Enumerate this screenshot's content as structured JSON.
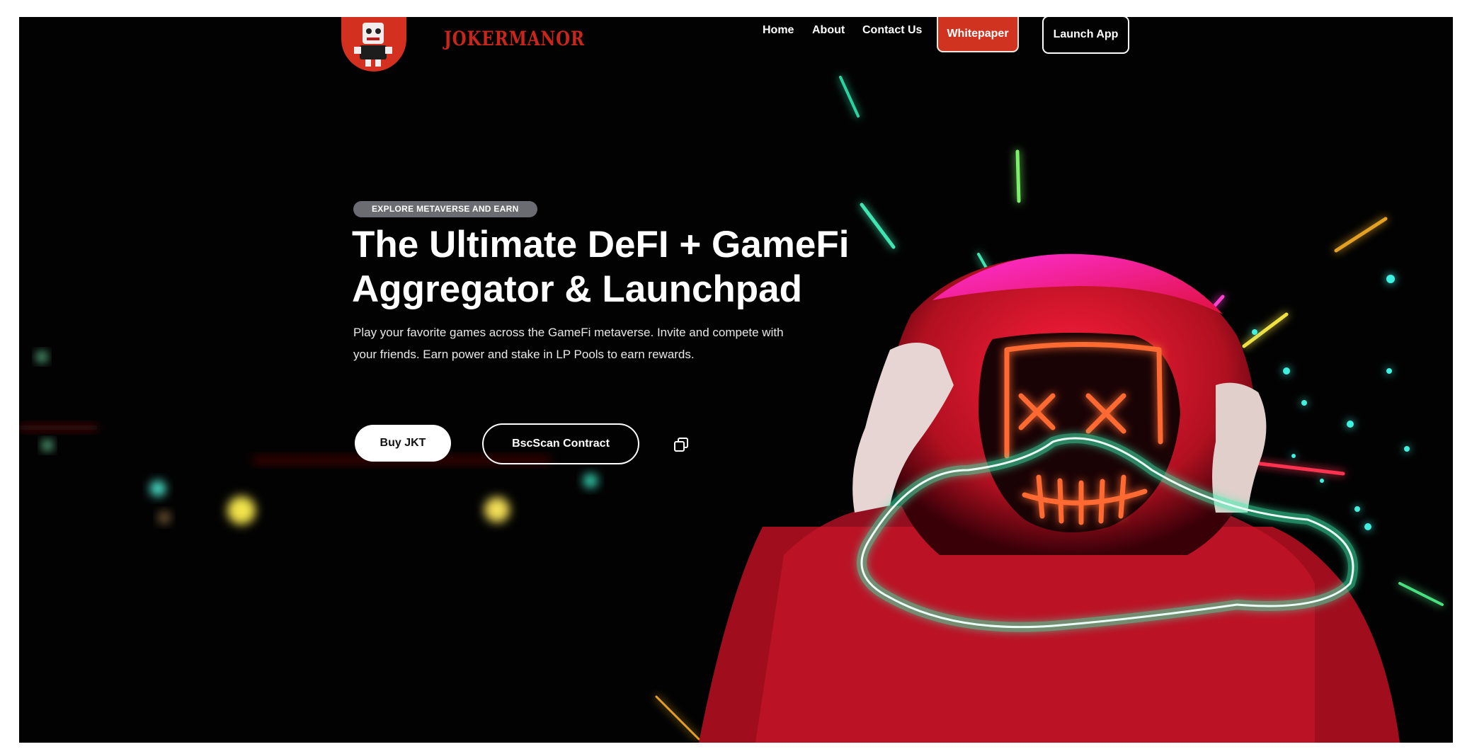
{
  "brand": {
    "name": "JOKERMANOR",
    "logo_icon": "joker-face-logo-icon",
    "accent_color": "#d0331f"
  },
  "nav": {
    "links": [
      "Home",
      "About",
      "Contact Us"
    ],
    "whitepaper_label": "Whitepaper",
    "launch_label": "Launch App"
  },
  "hero": {
    "eyebrow": "EXPLORE METAVERSE AND EARN",
    "title_line1": "The Ultimate DeFI + GameFi",
    "title_line2": "Aggregator & Launchpad",
    "description": "Play your favorite games across the GameFi metaverse. Invite and compete with your friends. Earn power and stake in LP Pools to earn rewards.",
    "buy_label": "Buy JKT",
    "bscscan_label": "BscScan Contract",
    "copy_icon": "copy-icon",
    "artwork": "neon-masked-hooded-figure-illustration"
  }
}
